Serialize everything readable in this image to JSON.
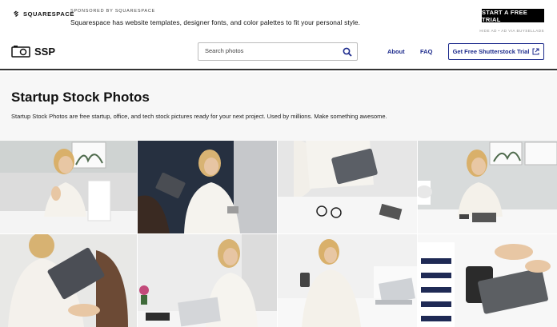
{
  "ad": {
    "brand": "SQUARESPACE",
    "sponsored": "SPONSORED BY SQUARESPACE",
    "text": "Squarespace has website templates, designer fonts, and color palettes to fit your personal style.",
    "cta": "START A FREE TRIAL",
    "hide": "HIDE AD • AD VIA BUYSELLADS"
  },
  "header": {
    "logo_text": "SSP",
    "search_placeholder": "Search photos",
    "nav": [
      "About",
      "FAQ"
    ],
    "trial_button": "Get Free Shutterstock Trial"
  },
  "hero": {
    "title": "Startup Stock Photos",
    "description": "Startup Stock Photos are free startup, office, and tech stock pictures ready for your next project. Used by millions. Make something awesome."
  },
  "icons": {
    "camera": "camera-icon",
    "search": "search-icon",
    "external_link": "external-link-icon",
    "squarespace": "squarespace-logo-icon"
  },
  "colors": {
    "nav": "#1c2a8c",
    "cta_bg": "#000000",
    "hero_bg": "#f7f7f7"
  }
}
